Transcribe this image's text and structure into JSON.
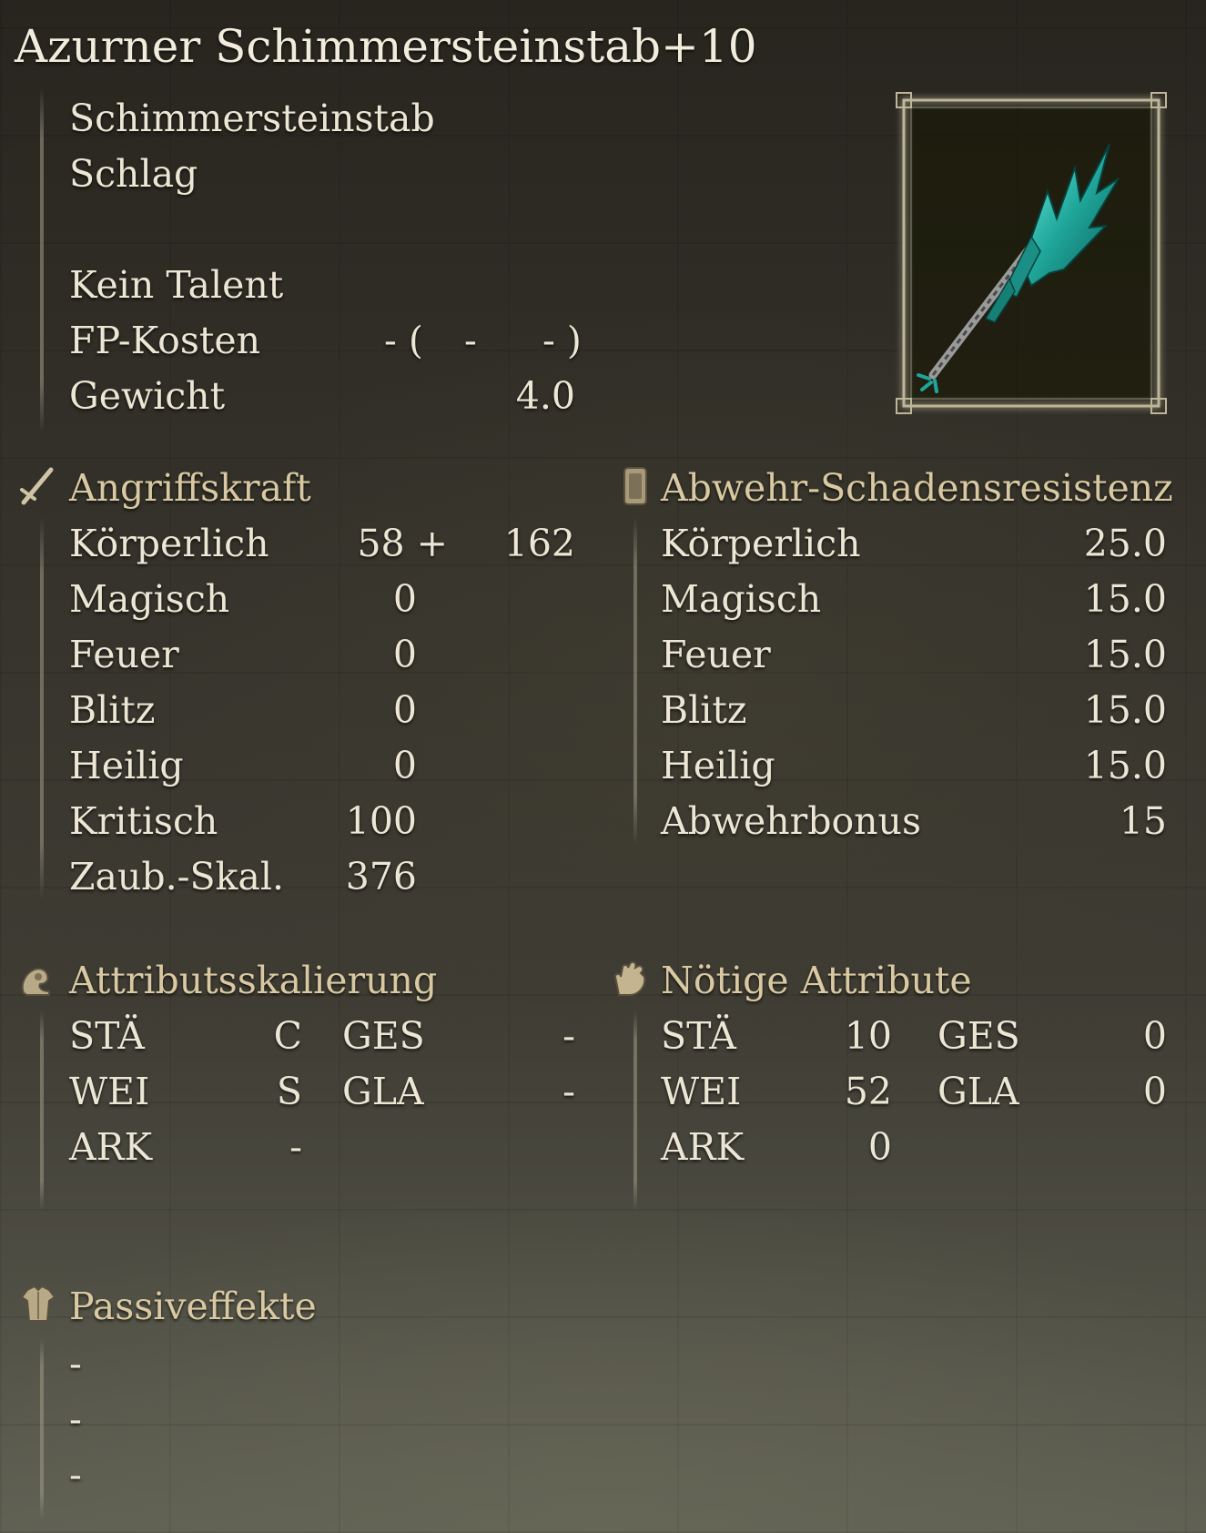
{
  "item": {
    "name": "Azurner Schimmersteinstab+10",
    "weapon_type": "Schimmersteinstab",
    "attack_type": "Schlag",
    "skill": "Kein Talent",
    "fp_cost": {
      "label": "FP-Kosten",
      "open": "- (",
      "mid": "-",
      "close": "- )"
    },
    "weight": {
      "label": "Gewicht",
      "value": "4.0"
    },
    "image_icon": "azure-glintstone-staff-icon"
  },
  "attack": {
    "header": "Angriffskraft",
    "icon": "sword-icon",
    "rows": [
      {
        "label": "Körperlich",
        "base": "58 +",
        "bonus": "162"
      },
      {
        "label": "Magisch",
        "base": "0"
      },
      {
        "label": "Feuer",
        "base": "0"
      },
      {
        "label": "Blitz",
        "base": "0"
      },
      {
        "label": "Heilig",
        "base": "0"
      },
      {
        "label": "Kritisch",
        "base": "100"
      },
      {
        "label": "Zaub.-Skal.",
        "base": "376"
      }
    ]
  },
  "guard": {
    "header": "Abwehr-Schadensresistenz",
    "icon": "shield-icon",
    "rows": [
      {
        "label": "Körperlich",
        "value": "25.0"
      },
      {
        "label": "Magisch",
        "value": "15.0"
      },
      {
        "label": "Feuer",
        "value": "15.0"
      },
      {
        "label": "Blitz",
        "value": "15.0"
      },
      {
        "label": "Heilig",
        "value": "15.0"
      },
      {
        "label": "Abwehrbonus",
        "value": "15"
      }
    ]
  },
  "scaling": {
    "header": "Attributsskalierung",
    "icon": "flexed-arm-icon",
    "rows": [
      {
        "a": "STÄ",
        "av": "C",
        "b": "GES",
        "bv": "-"
      },
      {
        "a": "WEI",
        "av": "S",
        "b": "GLA",
        "bv": "-"
      },
      {
        "a": "ARK",
        "av": "-"
      }
    ]
  },
  "requirements": {
    "header": "Nötige Attribute",
    "icon": "hand-icon",
    "rows": [
      {
        "a": "STÄ",
        "av": "10",
        "b": "GES",
        "bv": "0"
      },
      {
        "a": "WEI",
        "av": "52",
        "b": "GLA",
        "bv": "0"
      },
      {
        "a": "ARK",
        "av": "0"
      }
    ]
  },
  "passive": {
    "header": "Passiveffekte",
    "icon": "armor-icon",
    "effects": [
      "-",
      "-",
      "-"
    ]
  },
  "colors": {
    "text": "#ece6d4",
    "header": "#d9c9a2",
    "staff_crystal": "#2fc4b4"
  }
}
